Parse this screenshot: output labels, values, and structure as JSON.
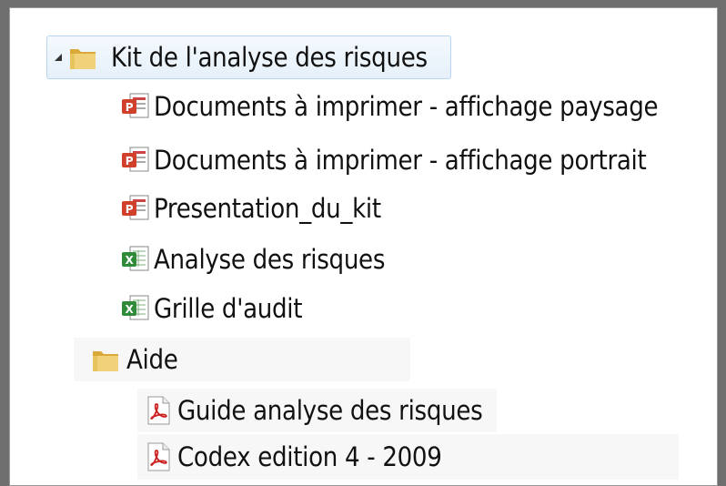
{
  "tree": {
    "root": {
      "label": "Kit de l'analyse des risques",
      "icon": "folder-icon"
    },
    "items": [
      {
        "label": "Documents à imprimer - affichage paysage",
        "icon": "powerpoint-icon"
      },
      {
        "label": "Documents à imprimer - affichage portrait",
        "icon": "powerpoint-icon"
      },
      {
        "label": "Presentation_du_kit",
        "icon": "powerpoint-icon"
      },
      {
        "label": "Analyse des risques",
        "icon": "excel-icon"
      },
      {
        "label": "Grille d'audit",
        "icon": "excel-icon"
      }
    ],
    "subfolder": {
      "label": "Aide",
      "icon": "folder-icon",
      "items": [
        {
          "label": "Guide analyse des risques",
          "icon": "pdf-icon"
        },
        {
          "label": "Codex edition 4 - 2009",
          "icon": "pdf-icon"
        }
      ]
    }
  },
  "colors": {
    "selection_bg": "#e6f0fa",
    "selection_border": "#b9d4ee",
    "folder": "#e8c560",
    "ppt": "#d0402a",
    "excel": "#2f8a3a",
    "pdf": "#cc1f1f"
  }
}
